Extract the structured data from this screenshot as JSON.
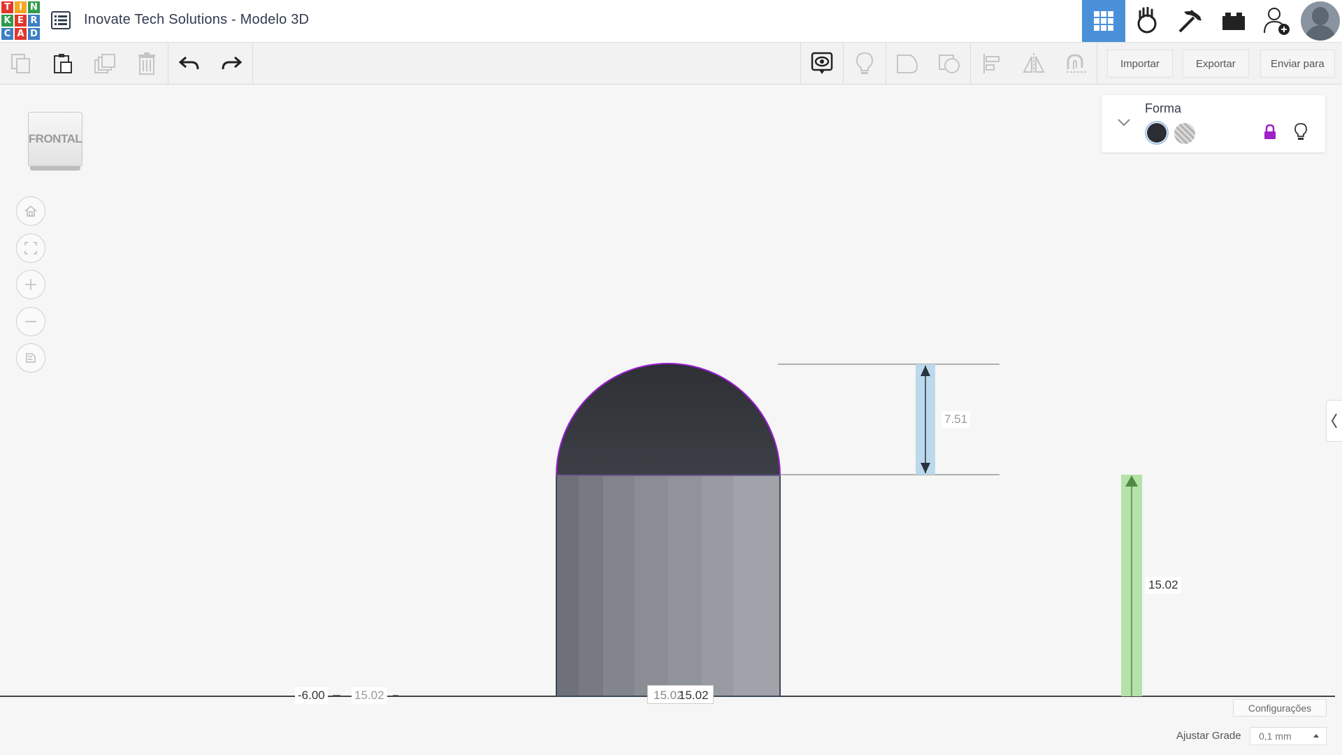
{
  "header": {
    "logo_letters": [
      "T",
      "I",
      "N",
      "K",
      "E",
      "R",
      "C",
      "A",
      "D"
    ],
    "logo_colors": [
      "#e2362b",
      "#f6a622",
      "#2f9b4b",
      "#2f9b4b",
      "#e2362b",
      "#3d7fc4",
      "#3d7fc4",
      "#e2362b",
      "#3d7fc4"
    ],
    "title": "Inovate Tech Solutions - Modelo 3D",
    "accent": "#4a90d9",
    "icons": [
      "grid-view-icon",
      "simulate-hand-icon",
      "pickaxe-icon",
      "bricks-icon",
      "add-user-icon",
      "avatar"
    ]
  },
  "toolbar": {
    "left_icons": [
      "copy-icon",
      "paste-icon",
      "duplicate-icon",
      "delete-icon",
      "undo-icon",
      "redo-icon"
    ],
    "right_icons": [
      "notes-icon",
      "light-bulb-icon",
      "group-icon",
      "ungroup-icon",
      "align-icon",
      "mirror-icon",
      "magnet-icon"
    ],
    "import_label": "Importar",
    "export_label": "Exportar",
    "send_label": "Enviar para"
  },
  "viewcube": {
    "face_label": "FRONTAL"
  },
  "nav_controls": [
    "home-icon",
    "fit-view-icon",
    "zoom-in-icon",
    "zoom-out-icon",
    "projection-icon"
  ],
  "shape_panel": {
    "title": "Forma",
    "solid_color": "#2a2d33",
    "lock_color": "#a020c8"
  },
  "dimensions": {
    "dome_height": "7.51",
    "elevation": "15.02",
    "left_offset": "-6.00",
    "left_width": "15.02",
    "bottom_width_a": "15.02",
    "bottom_width_b": "15.02"
  },
  "footer": {
    "settings_label": "Configurações",
    "grid_label": "Ajustar Grade",
    "grid_value": "0,1 mm"
  }
}
